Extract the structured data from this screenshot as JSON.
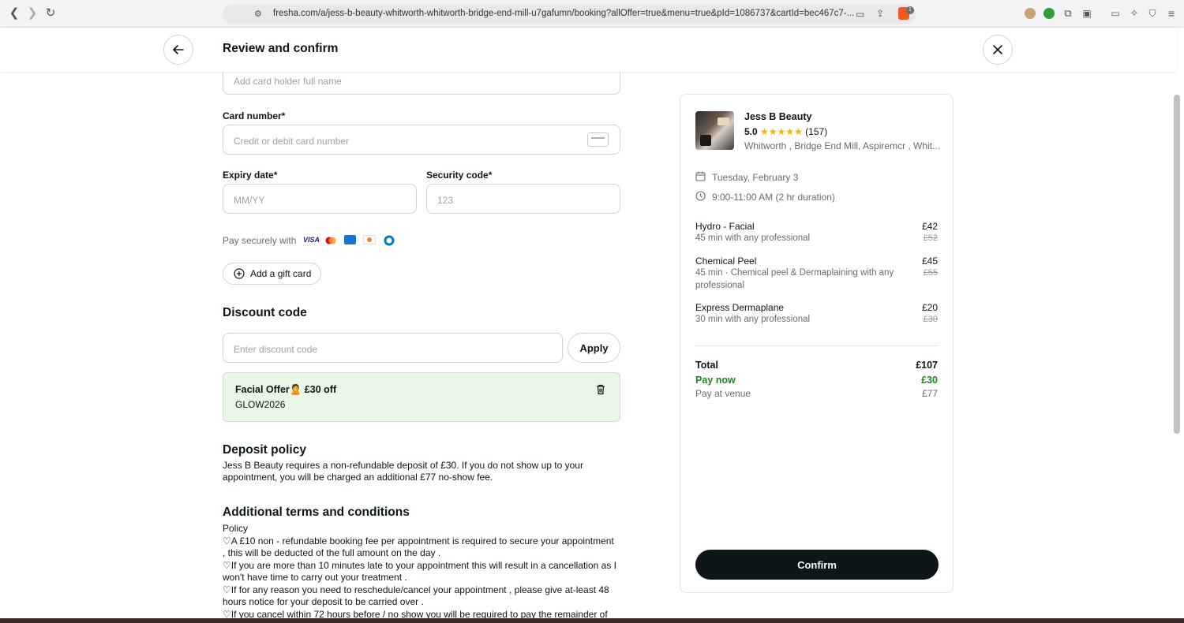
{
  "browser": {
    "url": "fresha.com/a/jess-b-beauty-whitworth-whitworth-bridge-end-mill-u7gafumn/booking?allOffer=true&menu=true&pId=1086737&cartId=bec467c7-...",
    "badge_count": "1"
  },
  "header": {
    "title": "Review and confirm"
  },
  "payment": {
    "cardholder_placeholder": "Add card holder full name",
    "card_number_label": "Card number*",
    "card_number_placeholder": "Credit or debit card number",
    "expiry_label": "Expiry date*",
    "expiry_placeholder": "MM/YY",
    "security_label": "Security code*",
    "security_placeholder": "123",
    "pay_securely": "Pay securely with",
    "gift_card_label": "Add a gift card"
  },
  "discount": {
    "heading": "Discount code",
    "placeholder": "Enter discount code",
    "apply_label": "Apply",
    "offer_title": "Facial Offer🙎 £30 off",
    "offer_code": "GLOW2026"
  },
  "deposit": {
    "heading": "Deposit policy",
    "line1": "Jess B Beauty requires a non-refundable deposit of £30. If you do not show up to your",
    "line2": "appointment, you will be charged an additional £77 no-show fee."
  },
  "terms": {
    "heading": "Additional terms and conditions",
    "lines": [
      "Policy",
      "♡A £10 non - refundable booking fee per appointment is required to secure your appointment",
      ", this will be deducted of the full amount on the day .",
      "♡If you are more than 10 minutes late to your appointment this will result in a cancellation as I",
      "won't have time to carry out your treatment .",
      "♡If for any reason you need to reschedule/cancel your appointment , please give at-least 48",
      "hours notice for your deposit to be carried over .",
      "♡If you cancel within 72 hours before / no show you will be required to pay the remainder of"
    ]
  },
  "summary": {
    "business_name": "Jess B Beauty",
    "rating": "5.0",
    "stars": "★★★★★",
    "review_count": "(157)",
    "address": "Whitworth , Bridge End Mill, Aspiremcr , Whit...",
    "date": "Tuesday, February 3",
    "time": "9:00-11:00 AM (2 hr duration)",
    "services": [
      {
        "name": "Hydro - Facial",
        "desc": "45 min with any professional",
        "price": "£42",
        "old_price": "£52"
      },
      {
        "name": "Chemical Peel",
        "desc": "45 min · Chemical peel & Dermaplaining with any professional",
        "price": "£45",
        "old_price": "£55"
      },
      {
        "name": "Express Dermaplane",
        "desc": "30 min with any professional",
        "price": "£20",
        "old_price": "£30"
      }
    ],
    "total_label": "Total",
    "total_value": "£107",
    "pay_now_label": "Pay now",
    "pay_now_value": "£30",
    "pay_venue_label": "Pay at venue",
    "pay_venue_value": "£77",
    "confirm_label": "Confirm"
  },
  "colors": {
    "accent_green": "#1a8a1a",
    "offer_bg": "#e8f7e6",
    "dark": "#0d1619",
    "star": "#f5b400"
  }
}
